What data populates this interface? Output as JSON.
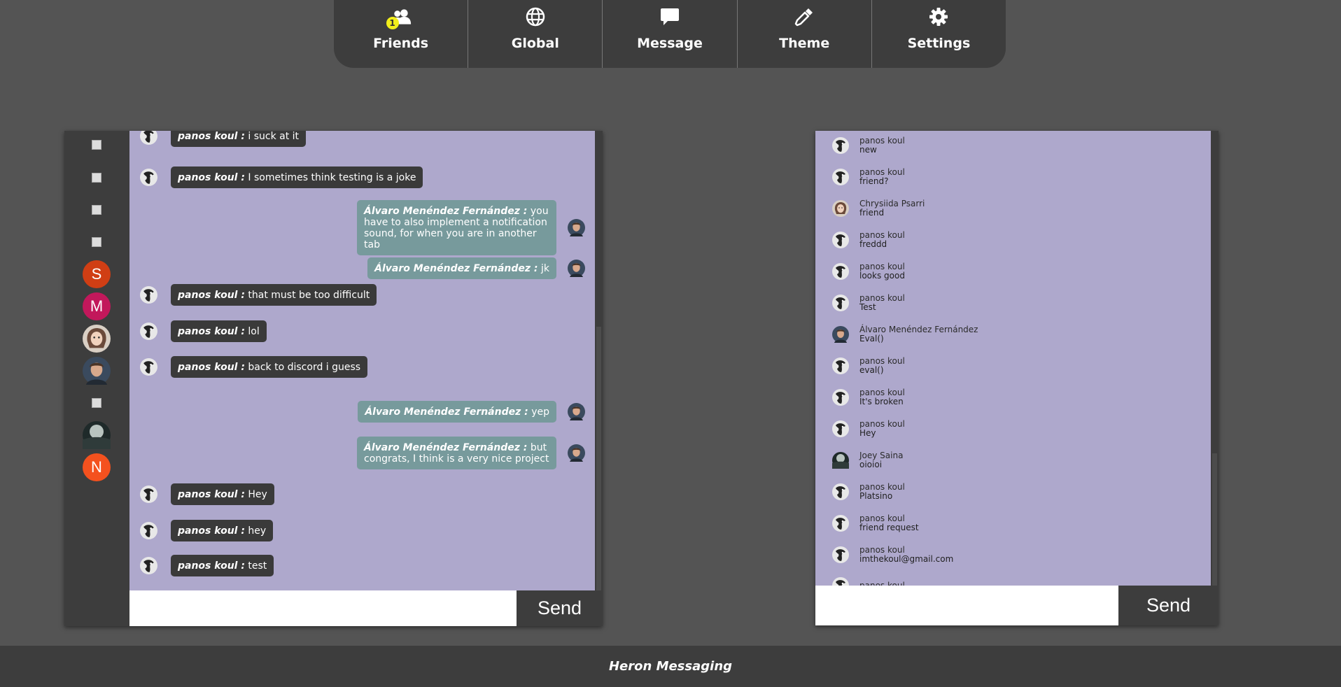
{
  "nav": {
    "items": [
      {
        "label": "Friends",
        "icon": "users-icon",
        "badge": "1"
      },
      {
        "label": "Global",
        "icon": "globe-icon"
      },
      {
        "label": "Message",
        "icon": "message-icon"
      },
      {
        "label": "Theme",
        "icon": "eyedropper-icon"
      },
      {
        "label": "Settings",
        "icon": "gear-icon"
      }
    ]
  },
  "sidebar": {
    "avatars": [
      {
        "type": "broken-image"
      },
      {
        "type": "broken-image"
      },
      {
        "type": "broken-image"
      },
      {
        "type": "broken-image"
      },
      {
        "type": "letter",
        "letter": "S",
        "color": "#d03e14"
      },
      {
        "type": "letter",
        "letter": "M",
        "color": "#c2185b"
      },
      {
        "type": "photo",
        "name": "woman-avatar"
      },
      {
        "type": "photo",
        "name": "man-avatar"
      },
      {
        "type": "broken-image"
      },
      {
        "type": "photo",
        "name": "moon-avatar"
      },
      {
        "type": "letter",
        "letter": "N",
        "color": "#f4511e"
      }
    ]
  },
  "chat": {
    "messages": [
      {
        "side": "left",
        "author": "panos koul :",
        "text": " i suck at it"
      },
      {
        "side": "left",
        "author": "panos koul :",
        "text": " I sometimes think testing is a joke"
      },
      {
        "side": "right",
        "author": "Álvaro Menéndez Fernández :",
        "text": " you have to also implement a notification sound, for when you are in another tab"
      },
      {
        "side": "right",
        "author": "Álvaro Menéndez Fernández :",
        "text": " jk"
      },
      {
        "side": "left",
        "author": "panos koul :",
        "text": " that must be too difficult"
      },
      {
        "side": "left",
        "author": "panos koul :",
        "text": " lol"
      },
      {
        "side": "left",
        "author": "panos koul :",
        "text": " back to discord i guess"
      },
      {
        "side": "right",
        "author": "Álvaro Menéndez Fernández :",
        "text": " yep"
      },
      {
        "side": "right",
        "author": "Álvaro Menéndez Fernández :",
        "text": " but congrats, I think is a very nice project"
      },
      {
        "side": "left",
        "author": "panos koul :",
        "text": " Hey"
      },
      {
        "side": "left",
        "author": "panos koul :",
        "text": " hey"
      },
      {
        "side": "left",
        "author": "panos koul :",
        "text": " test"
      }
    ],
    "input_value": "",
    "send_label": "Send"
  },
  "notifications": {
    "items": [
      {
        "name": "panos koul",
        "text": "new",
        "avatar": "bw"
      },
      {
        "name": "panos koul",
        "text": "friend?",
        "avatar": "bw"
      },
      {
        "name": "Chrysiida Psarri",
        "text": "friend",
        "avatar": "woman"
      },
      {
        "name": "panos koul",
        "text": "freddd",
        "avatar": "bw"
      },
      {
        "name": "panos koul",
        "text": "looks good",
        "avatar": "bw"
      },
      {
        "name": "panos koul",
        "text": "Test",
        "avatar": "bw"
      },
      {
        "name": "Álvaro Menéndez Fernández",
        "text": "Eval()",
        "avatar": "man"
      },
      {
        "name": "panos koul",
        "text": "eval()",
        "avatar": "bw"
      },
      {
        "name": "panos koul",
        "text": "It's broken",
        "avatar": "bw"
      },
      {
        "name": "panos koul",
        "text": "Hey",
        "avatar": "bw"
      },
      {
        "name": "Joey Saina",
        "text": "oioioi",
        "avatar": "moon"
      },
      {
        "name": "panos koul",
        "text": "Platsino",
        "avatar": "bw"
      },
      {
        "name": "panos koul",
        "text": "friend request",
        "avatar": "bw"
      },
      {
        "name": "panos koul",
        "text": "imthekoul@gmail.com",
        "avatar": "bw"
      },
      {
        "name": "panos koul",
        "text": "",
        "avatar": "bw"
      }
    ],
    "input_value": "",
    "send_label": "Send"
  },
  "footer": {
    "title": "Heron Messaging"
  }
}
